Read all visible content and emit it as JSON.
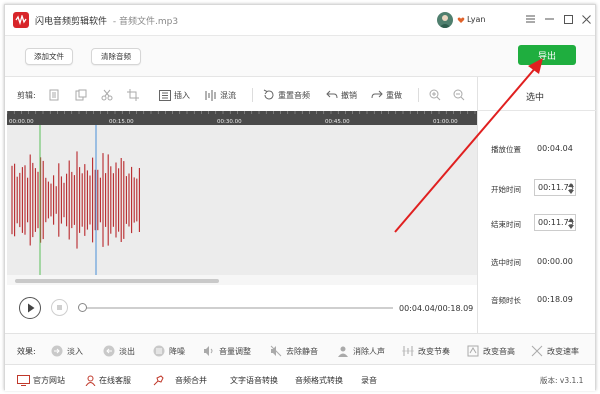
{
  "window": {
    "app_name": "闪电音频剪辑软件",
    "file_name": "- 音频文件.mp3",
    "username": "Lyan",
    "controls": [
      "menu-icon",
      "minimize-icon",
      "maximize-icon",
      "close-icon"
    ]
  },
  "filebar": {
    "add_file": "添加文件",
    "clear_audio": "清除音频",
    "export": "导出"
  },
  "toolbar": {
    "label": "剪辑:",
    "insert": "插入",
    "mix": "混流",
    "rerecord": "重置音频",
    "undo": "撤销",
    "redo": "重做"
  },
  "timeline": {
    "ticks": [
      "00:00.00",
      "00:15.00",
      "00:30.00",
      "00:45.00",
      "01:00.00"
    ]
  },
  "right_panel": {
    "title": "选中",
    "play_position_label": "播放位置",
    "play_position_value": "00:04.04",
    "start_time_label": "开始时间",
    "start_time_value": "00:11.73",
    "end_time_label": "结束时间",
    "end_time_value": "00:11.73",
    "selected_time_label": "选中时间",
    "selected_time_value": "00:00.00",
    "duration_label": "音频时长",
    "duration_value": "00:18.09"
  },
  "playback": {
    "time": "00:04.04/00:18.09",
    "progress": 0.02
  },
  "effects": {
    "label": "效果:",
    "items": [
      "淡入",
      "淡出",
      "降噪",
      "音量调整",
      "去除静音",
      "消除人声",
      "改变节奏",
      "改变音高",
      "改变速率"
    ]
  },
  "bottom": {
    "official_site": "官方网站",
    "support": "在线客服",
    "merge": "音频合并",
    "tts": "文字语音转换",
    "format": "音频格式转换",
    "record": "录音",
    "version": "版本: v3.1.1"
  },
  "colors": {
    "accent_green": "#1fae3f",
    "waveform": "#b8272b",
    "annotation_red": "#e02020",
    "start_marker": "#5ac05a",
    "playhead": "#4a90d9"
  }
}
